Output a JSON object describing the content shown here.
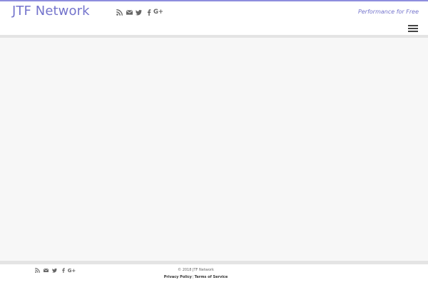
{
  "header": {
    "brand": "JTF Network",
    "tagline": "Performance for Free",
    "social_icons": [
      "rss-icon",
      "envelope-icon",
      "twitter-icon",
      "facebook-icon",
      "google-plus-icon"
    ],
    "google_plus_glyph": "G+"
  },
  "footer": {
    "social_icons": [
      "rss-icon",
      "envelope-icon",
      "twitter-icon",
      "facebook-icon",
      "google-plus-icon"
    ],
    "google_plus_glyph": "G+",
    "copyright": "© 2018 JTF Network",
    "privacy_label": "Privacy Policy",
    "separator": "|",
    "terms_label": "Terms of Service"
  },
  "colors": {
    "accent": "#8e8ede",
    "brand": "#7474cc",
    "background": "#f7f7f7",
    "icon": "#666666"
  }
}
